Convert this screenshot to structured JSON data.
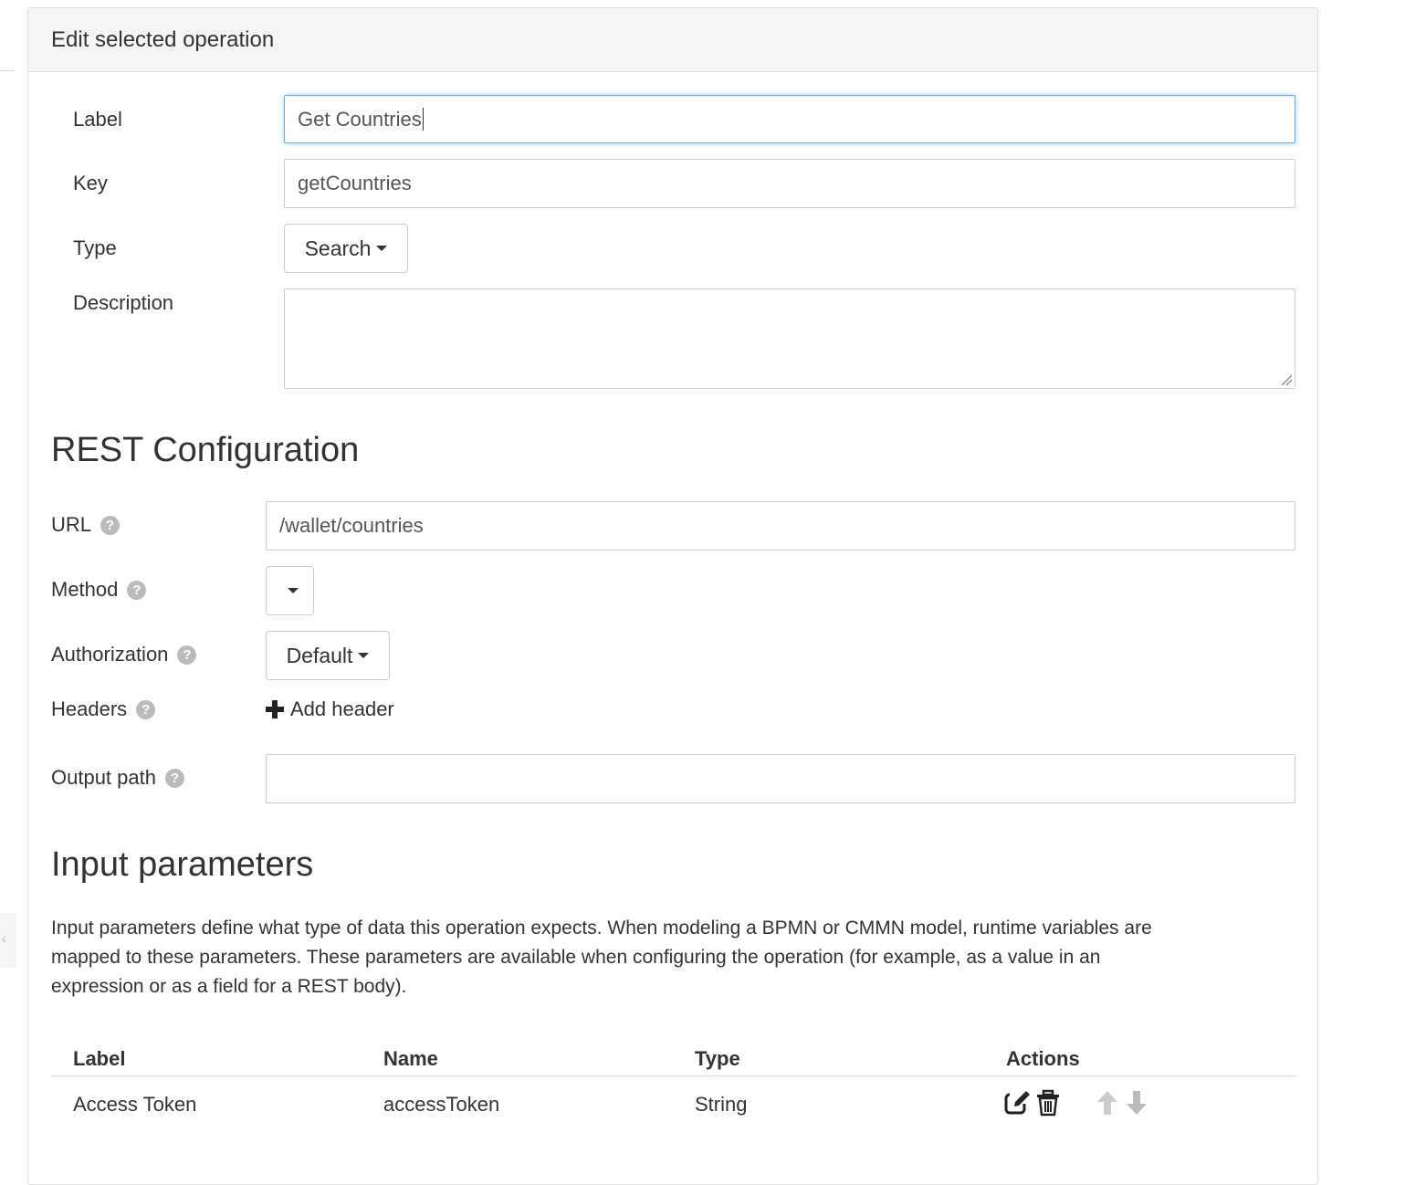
{
  "panel": {
    "title": "Edit selected operation"
  },
  "form": {
    "label": {
      "label": "Label",
      "value": "Get Countries"
    },
    "key": {
      "label": "Key",
      "value": "getCountries"
    },
    "type": {
      "label": "Type",
      "value": "Search"
    },
    "description": {
      "label": "Description",
      "value": ""
    }
  },
  "rest": {
    "title": "REST Configuration",
    "url": {
      "label": "URL",
      "value": "/wallet/countries"
    },
    "method": {
      "label": "Method",
      "value": ""
    },
    "authorization": {
      "label": "Authorization",
      "value": "Default"
    },
    "headers": {
      "label": "Headers",
      "add_label": "Add header"
    },
    "output_path": {
      "label": "Output path",
      "value": ""
    }
  },
  "input_params": {
    "title": "Input parameters",
    "description": "Input parameters define what type of data this operation expects. When modeling a BPMN or CMMN model, runtime variables are mapped to these parameters. These parameters are available when configuring the operation (for example, as a value in an expression or as a field for a REST body).",
    "columns": {
      "label": "Label",
      "name": "Name",
      "type": "Type",
      "actions": "Actions"
    },
    "rows": [
      {
        "label": "Access Token",
        "name": "accessToken",
        "type": "String"
      }
    ]
  },
  "help_glyph": "?",
  "icons": [
    "question-circle-icon",
    "plus-icon",
    "caret-down-icon",
    "edit-icon",
    "trash-icon",
    "arrow-up-icon",
    "arrow-down-icon"
  ],
  "colors": {
    "focus_border": "#66afe9",
    "help_icon": "#bbbbbb",
    "panel_heading_bg": "#f5f5f5",
    "disabled_arrow": "#cccccc"
  }
}
